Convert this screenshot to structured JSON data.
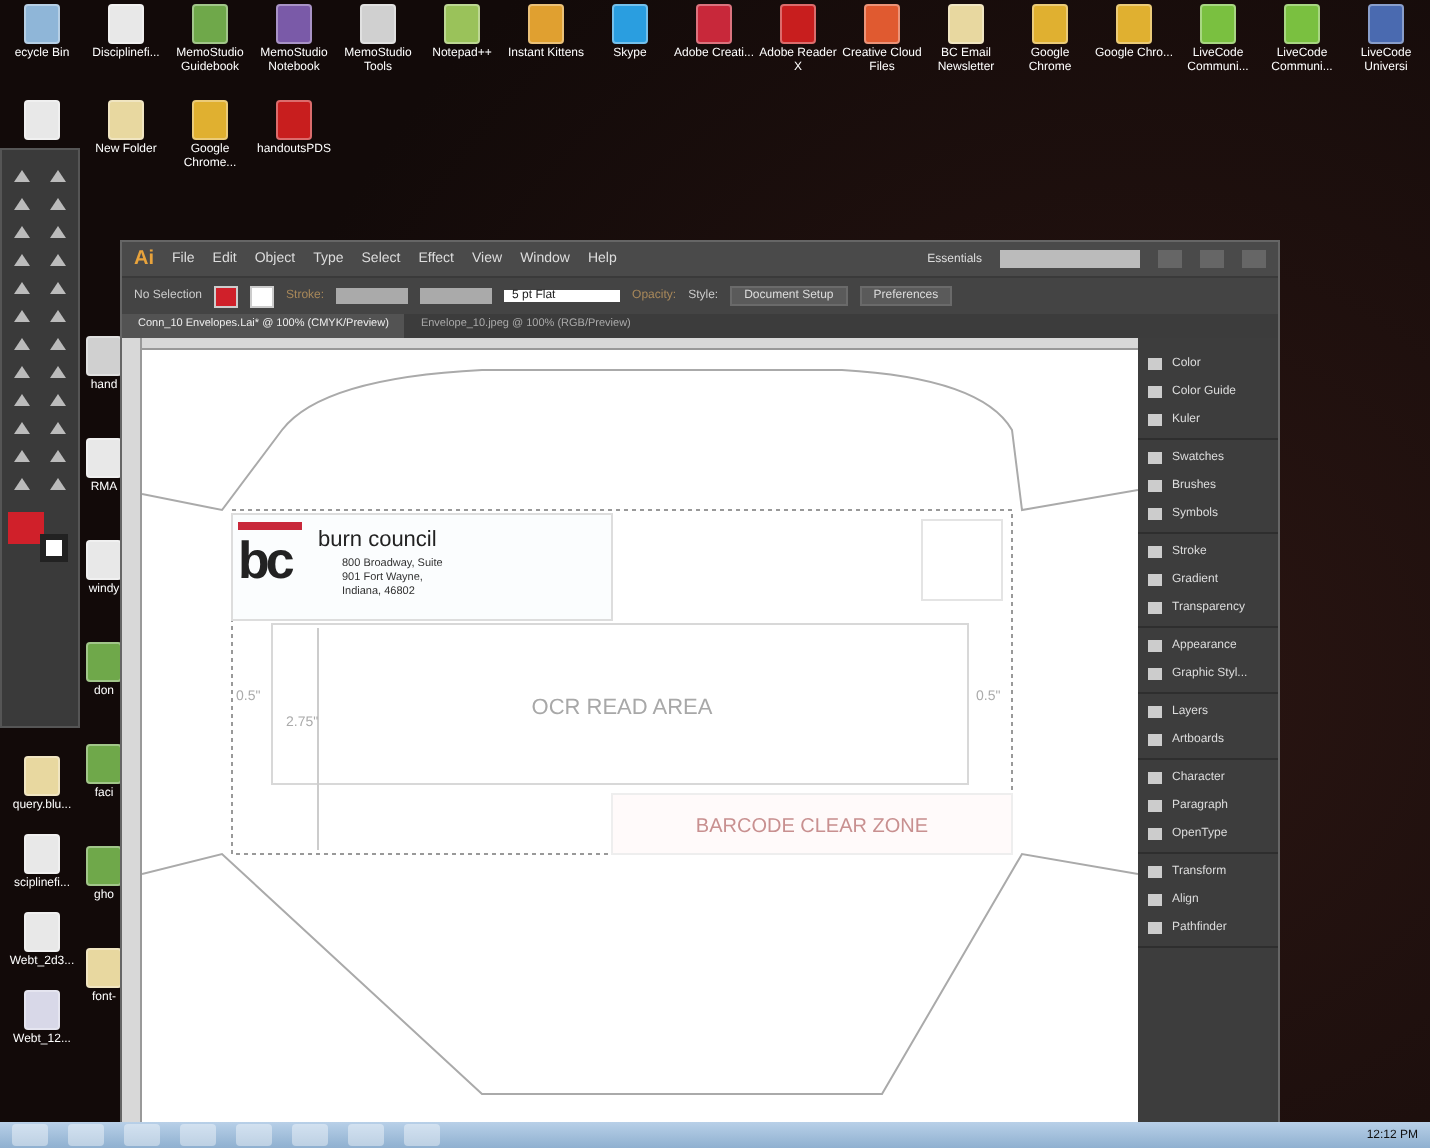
{
  "desktop_icons": [
    {
      "label": "ecycle Bin",
      "color": "#8fb6d8"
    },
    {
      "label": "Disciplinefi...",
      "color": "#e8e8e8"
    },
    {
      "label": "MemoStudio Guidebook",
      "color": "#6fa84a"
    },
    {
      "label": "MemoStudio Notebook",
      "color": "#7a5aa8"
    },
    {
      "label": "MemoStudio Tools",
      "color": "#d0d0d0"
    },
    {
      "label": "Notepad++",
      "color": "#9ac25a"
    },
    {
      "label": "Instant Kittens",
      "color": "#e0a030"
    },
    {
      "label": "Skype",
      "color": "#2a9ee0"
    },
    {
      "label": "Adobe Creati...",
      "color": "#c8283a"
    },
    {
      "label": "Adobe Reader X",
      "color": "#c81e1e"
    },
    {
      "label": "Creative Cloud Files",
      "color": "#e05a30"
    },
    {
      "label": "BC Email Newsletter",
      "color": "#e8d8a0"
    },
    {
      "label": "Google Chrome",
      "color": "#e0b030"
    },
    {
      "label": "Google Chro...",
      "color": "#e0b030"
    },
    {
      "label": "LiveCode Communi...",
      "color": "#7ac040"
    },
    {
      "label": "LiveCode Communi...",
      "color": "#7ac040"
    },
    {
      "label": "LiveCode Universi",
      "color": "#4a6ab0"
    }
  ],
  "desktop_icons_row2": [
    {
      "color": "#e8e8e8"
    },
    {
      "label": "New Folder",
      "color": "#e8d8a0"
    },
    {
      "label": "Google Chrome...",
      "color": "#e0b030"
    },
    {
      "label": "handoutsPDS",
      "color": "#c81e1e"
    }
  ],
  "desktop_icons_left": [
    {
      "label": "query.blu...",
      "color": "#e8d8a0"
    },
    {
      "label": "sciplinefi...",
      "color": "#e8e8e8"
    },
    {
      "label": "Webt_2d3...",
      "color": "#e8e8e8"
    },
    {
      "label": "Webt_12...",
      "color": "#d8d8e8"
    }
  ],
  "desktop_icons_behind": [
    {
      "label": "hand",
      "color": "#d0d0d0"
    },
    {
      "label": "RMA",
      "color": "#e8e8e8"
    },
    {
      "label": "windy",
      "color": "#e8e8e8"
    },
    {
      "label": "don",
      "color": "#6fa84a"
    },
    {
      "label": "faci",
      "color": "#6fa84a"
    },
    {
      "label": "gho",
      "color": "#6fa84a"
    },
    {
      "label": "font-",
      "color": "#e8d8a0"
    }
  ],
  "tools_panel": {
    "fill_swatch": {
      "color": "#d0202a"
    }
  },
  "illustrator": {
    "app_logo": "Ai",
    "menu": [
      "File",
      "Edit",
      "Object",
      "Type",
      "Select",
      "Effect",
      "View",
      "Window",
      "Help"
    ],
    "workspace": "Essentials",
    "control_bar": {
      "selection": "No Selection",
      "stroke_label": "Stroke:",
      "stroke_profile": "5 pt Flat",
      "opacity_label": "Opacity:",
      "style_label": "Style:",
      "buttons": [
        "Document Setup",
        "Preferences"
      ]
    },
    "tabs": [
      {
        "label": "Conn_10 Envelopes.Lai* @ 100% (CMYK/Preview)",
        "selected": true
      },
      {
        "label": "Envelope_10.jpeg @ 100% (RGB/Preview)",
        "selected": false
      }
    ],
    "artboard": {
      "logo_text": "bc",
      "org_name": "burn council",
      "address": [
        "800 Broadway, Suite",
        "901 Fort Wayne,",
        "Indiana, 46802"
      ],
      "ocr_label": "OCR READ AREA",
      "barcode_label": "BARCODE CLEAR ZONE",
      "left_margin": "0.5\"",
      "right_margin": "0.5\"",
      "height_label": "2.75\""
    },
    "panels": [
      [
        {
          "label": "Color"
        },
        {
          "label": "Color Guide"
        },
        {
          "label": "Kuler"
        }
      ],
      [
        {
          "label": "Swatches"
        },
        {
          "label": "Brushes"
        },
        {
          "label": "Symbols"
        }
      ],
      [
        {
          "label": "Stroke"
        },
        {
          "label": "Gradient"
        },
        {
          "label": "Transparency"
        }
      ],
      [
        {
          "label": "Appearance"
        },
        {
          "label": "Graphic Styl..."
        }
      ],
      [
        {
          "label": "Layers"
        },
        {
          "label": "Artboards"
        }
      ],
      [
        {
          "label": "Character"
        },
        {
          "label": "Paragraph"
        },
        {
          "label": "OpenType"
        }
      ],
      [
        {
          "label": "Transform"
        },
        {
          "label": "Align"
        },
        {
          "label": "Pathfinder"
        }
      ]
    ]
  },
  "taskbar": {
    "clock": "12:12 PM"
  }
}
